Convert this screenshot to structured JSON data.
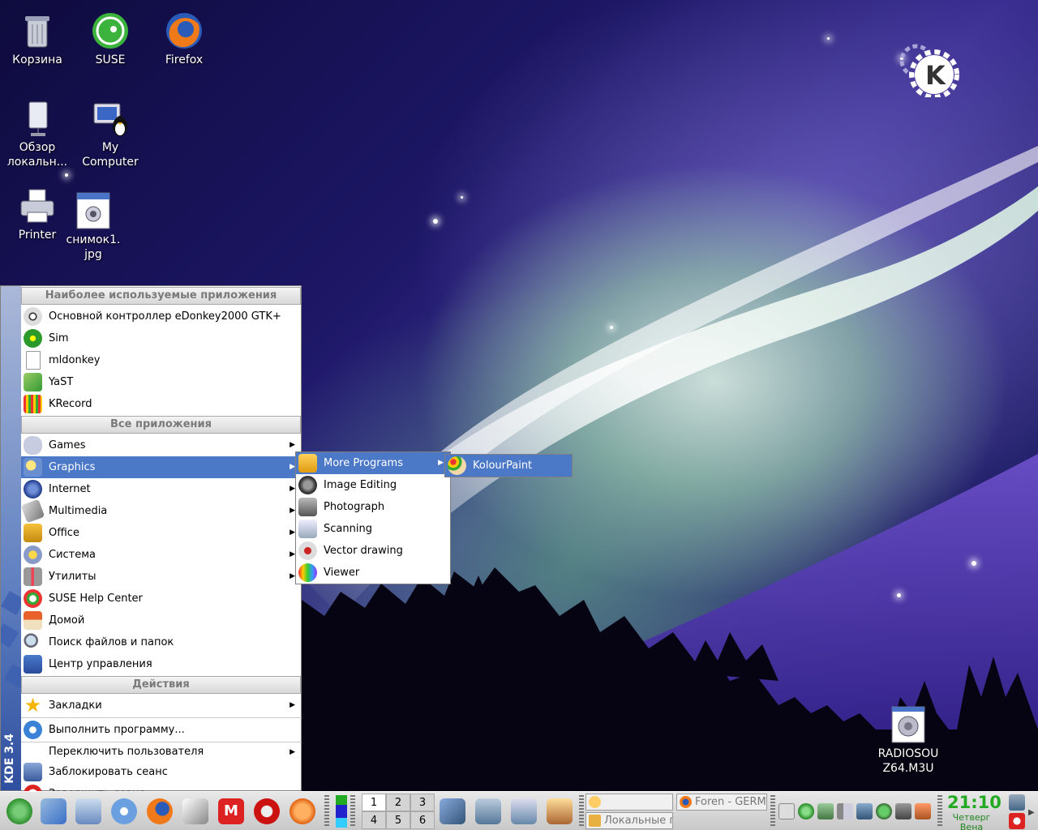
{
  "desktop": {
    "icons": [
      {
        "label": "Корзина"
      },
      {
        "label": "SUSE"
      },
      {
        "label": "Firefox"
      },
      {
        "label": "Обзор локальн..."
      },
      {
        "label": "My Computer"
      },
      {
        "label": "Printer"
      },
      {
        "label": "снимок1. jpg"
      },
      {
        "label": "RADIOSOU Z64.M3U"
      }
    ]
  },
  "kmenu": {
    "version_label": "KDE 3.4",
    "sections": {
      "most_used": "Наиболее используемые приложения",
      "all_apps": "Все приложения",
      "actions": "Действия"
    },
    "most_used_items": [
      {
        "label": "Основной контроллер eDonkey2000 GTK+",
        "icon": "radiation-icon"
      },
      {
        "label": "Sim",
        "icon": "flower-icon"
      },
      {
        "label": "mldonkey",
        "icon": "document-icon"
      },
      {
        "label": "YaST",
        "icon": "yast-icon"
      },
      {
        "label": "KRecord",
        "icon": "equalizer-icon"
      }
    ],
    "all_apps_items": [
      {
        "label": "Games",
        "icon": "gamepad-icon",
        "submenu": true
      },
      {
        "label": "Graphics",
        "icon": "graphics-icon",
        "submenu": true,
        "highlighted": true
      },
      {
        "label": "Internet",
        "icon": "globe-icon",
        "submenu": true
      },
      {
        "label": "Multimedia",
        "icon": "multimedia-icon",
        "submenu": true
      },
      {
        "label": "Office",
        "icon": "office-icon",
        "submenu": true
      },
      {
        "label": "Система",
        "icon": "system-icon",
        "submenu": true
      },
      {
        "label": "Утилиты",
        "icon": "utilities-icon",
        "submenu": true
      },
      {
        "label": "SUSE Help Center",
        "icon": "help-icon",
        "submenu": false
      },
      {
        "label": "Домой",
        "icon": "home-icon",
        "submenu": false
      },
      {
        "label": "Поиск файлов и папок",
        "icon": "search-icon",
        "submenu": false
      },
      {
        "label": "Центр управления",
        "icon": "control-center-icon",
        "submenu": false
      }
    ],
    "actions_items": {
      "bookmarks": "Закладки",
      "run": "Выполнить программу...",
      "switch_user": "Переключить пользователя",
      "lock": "Заблокировать сеанс",
      "logout": "Завершить сеанс..."
    }
  },
  "graphics_submenu": [
    {
      "label": "More Programs",
      "submenu": true,
      "highlighted": true
    },
    {
      "label": "Image Editing"
    },
    {
      "label": "Photograph"
    },
    {
      "label": "Scanning"
    },
    {
      "label": "Vector drawing"
    },
    {
      "label": "Viewer"
    }
  ],
  "more_programs_submenu": [
    {
      "label": "KolourPaint",
      "highlighted": true
    }
  ],
  "taskbar": {
    "pager": [
      "1",
      "2",
      "3",
      "4",
      "5",
      "6"
    ],
    "active_desktop": "1",
    "tasks": [
      {
        "label": ""
      },
      {
        "label": "Foren - GERM"
      },
      {
        "label": "Локальные па"
      }
    ],
    "clock": {
      "time": "21:10",
      "day": "Четверг",
      "city": "Вена"
    }
  },
  "colors": {
    "highlight": "#4b78c7",
    "clock": "#22aa22"
  }
}
